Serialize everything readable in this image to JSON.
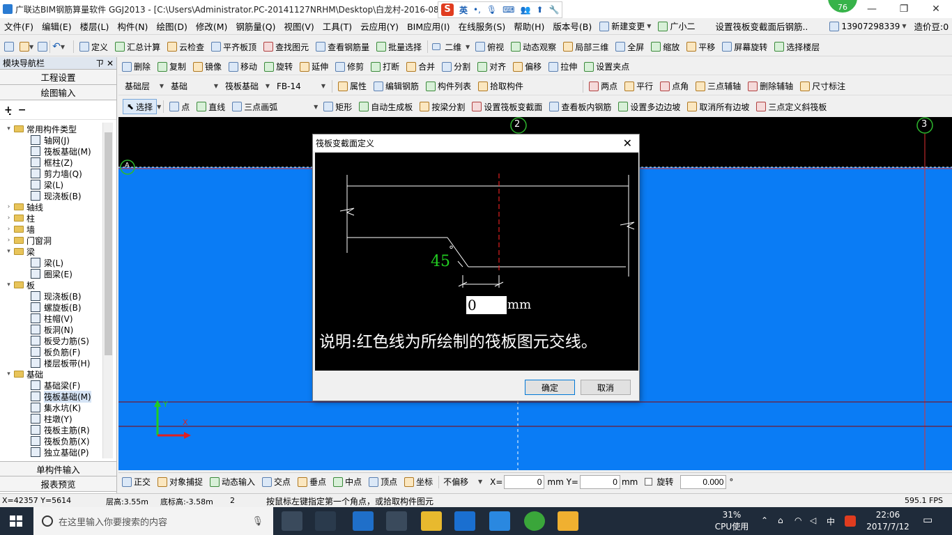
{
  "title_bar": {
    "title": "广联达BIM钢筋算量软件 GGJ2013 - [C:\\Users\\Administrator.PC-20141127NRHM\\Desktop\\白龙村-2016-08-",
    "ime_lang": "英",
    "badge_value": "76",
    "minimize": "—",
    "maximize": "❐",
    "close": "✕"
  },
  "menu": {
    "items": [
      "文件(F)",
      "编辑(E)",
      "楼层(L)",
      "构件(N)",
      "绘图(D)",
      "修改(M)",
      "钢筋量(Q)",
      "视图(V)",
      "工具(T)",
      "云应用(Y)",
      "BIM应用(I)",
      "在线服务(S)",
      "帮助(H)",
      "版本号(B)"
    ],
    "new_change": "新建变更",
    "assistant": "广小二",
    "hint": "设置筏板变截面后钢筋..",
    "phone": "13907298339",
    "price_bean": "造价豆:0"
  },
  "toolbar1": {
    "items": [
      "定义",
      "汇总计算",
      "云检查",
      "平齐板顶",
      "查找图元",
      "查看钢筋量",
      "批量选择"
    ],
    "view_mode": "二维",
    "view_items": [
      "俯视",
      "动态观察",
      "局部三维",
      "全屏",
      "缩放",
      "平移",
      "屏幕旋转",
      "选择楼层"
    ]
  },
  "navigator": {
    "title": "模块导航栏",
    "pin": "ㄗ",
    "close": "✕",
    "project_settings": "工程设置",
    "drawing_input": "绘图输入",
    "single_input": "单构件输入",
    "report_preview": "报表预览",
    "tree": [
      {
        "level": 0,
        "exp": "▾",
        "type": "folder",
        "label": "常用构件类型"
      },
      {
        "level": 1,
        "type": "leaf",
        "label": "轴网(J)"
      },
      {
        "level": 1,
        "type": "leaf",
        "label": "筏板基础(M)"
      },
      {
        "level": 1,
        "type": "leaf",
        "label": "框柱(Z)"
      },
      {
        "level": 1,
        "type": "leaf",
        "label": "剪力墙(Q)"
      },
      {
        "level": 1,
        "type": "leaf",
        "label": "梁(L)"
      },
      {
        "level": 1,
        "type": "leaf",
        "label": "现浇板(B)"
      },
      {
        "level": 0,
        "exp": "›",
        "type": "folder",
        "label": "轴线"
      },
      {
        "level": 0,
        "exp": "›",
        "type": "folder",
        "label": "柱"
      },
      {
        "level": 0,
        "exp": "›",
        "type": "folder",
        "label": "墙"
      },
      {
        "level": 0,
        "exp": "›",
        "type": "folder",
        "label": "门窗洞"
      },
      {
        "level": 0,
        "exp": "▾",
        "type": "folder",
        "label": "梁"
      },
      {
        "level": 1,
        "type": "leaf",
        "label": "梁(L)"
      },
      {
        "level": 1,
        "type": "leaf",
        "label": "圈梁(E)"
      },
      {
        "level": 0,
        "exp": "▾",
        "type": "folder",
        "label": "板"
      },
      {
        "level": 1,
        "type": "leaf",
        "label": "现浇板(B)"
      },
      {
        "level": 1,
        "type": "leaf",
        "label": "螺旋板(B)"
      },
      {
        "level": 1,
        "type": "leaf",
        "label": "柱帽(V)"
      },
      {
        "level": 1,
        "type": "leaf",
        "label": "板洞(N)"
      },
      {
        "level": 1,
        "type": "leaf",
        "label": "板受力筋(S)"
      },
      {
        "level": 1,
        "type": "leaf",
        "label": "板负筋(F)"
      },
      {
        "level": 1,
        "type": "leaf",
        "label": "楼层板带(H)"
      },
      {
        "level": 0,
        "exp": "▾",
        "type": "folder",
        "label": "基础"
      },
      {
        "level": 1,
        "type": "leaf",
        "label": "基础梁(F)"
      },
      {
        "level": 1,
        "type": "leaf",
        "label": "筏板基础(M)",
        "selected": true
      },
      {
        "level": 1,
        "type": "leaf",
        "label": "集水坑(K)"
      },
      {
        "level": 1,
        "type": "leaf",
        "label": "柱墩(Y)"
      },
      {
        "level": 1,
        "type": "leaf",
        "label": "筏板主筋(R)"
      },
      {
        "level": 1,
        "type": "leaf",
        "label": "筏板负筋(X)"
      },
      {
        "level": 1,
        "type": "leaf",
        "label": "独立基础(P)"
      }
    ]
  },
  "toolbar2": {
    "items": [
      "删除",
      "复制",
      "镜像",
      "移动",
      "旋转",
      "延伸",
      "修剪",
      "打断",
      "合并",
      "分割",
      "对齐",
      "偏移",
      "拉伸",
      "设置夹点"
    ]
  },
  "toolbar3": {
    "floor": "基础层",
    "category": "基础",
    "type": "筏板基础",
    "component": "FB-14",
    "items": [
      "属性",
      "编辑钢筋",
      "构件列表",
      "拾取构件"
    ],
    "axis_items": [
      "两点",
      "平行",
      "点角",
      "三点辅轴",
      "删除辅轴",
      "尺寸标注"
    ]
  },
  "toolbar4": {
    "select": "选择",
    "items": [
      "点",
      "直线",
      "三点画弧"
    ],
    "items2": [
      "矩形",
      "自动生成板",
      "按梁分割",
      "设置筏板变截面",
      "查看板内钢筋",
      "设置多边边坡",
      "取消所有边坡",
      "三点定义斜筏板"
    ]
  },
  "canvas": {
    "axis_2": "2",
    "axis_3": "3",
    "axis_a": "A",
    "ucs_y": "Y",
    "ucs_x": "X"
  },
  "dialog": {
    "title": "筏板变截面定义",
    "angle_label": "45",
    "degree": "°",
    "input_value": "0",
    "unit": "mm",
    "note": "说明:红色线为所绘制的筏板图元交线。",
    "ok": "确定",
    "cancel": "取消"
  },
  "snapbar": {
    "items": [
      "正交",
      "对象捕捉",
      "动态输入",
      "交点",
      "垂点",
      "中点",
      "顶点",
      "坐标"
    ],
    "offset_mode": "不偏移",
    "x_label": "X=",
    "x_value": "0",
    "y_label": "mm Y=",
    "y_value": "0",
    "y_unit": "mm",
    "rotate_label": "旋转",
    "rotate_value": "0.000",
    "rotate_unit": "°"
  },
  "status": {
    "coords": "X=42357 Y=5614",
    "floor_height": "层高:3.55m",
    "bottom_height": "底标高:-3.58m",
    "count": "2",
    "hint": "按鼠标左键指定第一个角点，或拾取构件图元",
    "fps": "595.1 FPS"
  },
  "taskbar": {
    "search_placeholder": "在这里输入你要搜索的内容",
    "cpu_percent": "31%",
    "cpu_label": "CPU使用",
    "ime": "中",
    "time": "22:06",
    "date": "2017/7/12"
  }
}
